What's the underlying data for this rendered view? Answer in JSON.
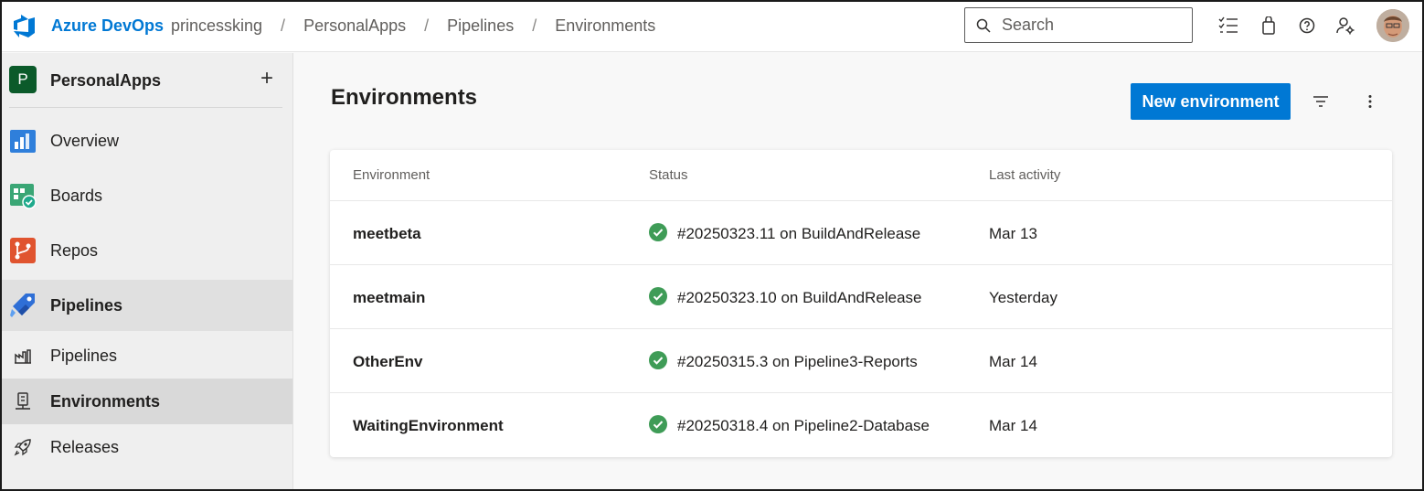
{
  "header": {
    "brand": "Azure DevOps",
    "breadcrumbs": [
      "princessking",
      "PersonalApps",
      "Pipelines",
      "Environments"
    ],
    "breadcrumb_separator": "/",
    "search_placeholder": "Search",
    "icons": [
      "checklist-icon",
      "shopping-bag-icon",
      "help-icon",
      "user-settings-icon"
    ]
  },
  "sidebar": {
    "project_initial": "P",
    "project_name": "PersonalApps",
    "add_label": "+",
    "items": [
      {
        "label": "Overview",
        "icon": "overview-icon"
      },
      {
        "label": "Boards",
        "icon": "boards-icon"
      },
      {
        "label": "Repos",
        "icon": "repos-icon"
      },
      {
        "label": "Pipelines",
        "icon": "pipelines-icon",
        "active": true
      }
    ],
    "subitems": [
      {
        "label": "Pipelines",
        "icon": "pipeline-list-icon"
      },
      {
        "label": "Environments",
        "icon": "environment-icon",
        "selected": true
      },
      {
        "label": "Releases",
        "icon": "rocket-icon"
      }
    ]
  },
  "main": {
    "title": "Environments",
    "new_button": "New environment",
    "table": {
      "columns": [
        "Environment",
        "Status",
        "Last activity"
      ],
      "rows": [
        {
          "name": "meetbeta",
          "status": "#20250323.11 on BuildAndRelease",
          "activity": "Mar 13"
        },
        {
          "name": "meetmain",
          "status": "#20250323.10 on BuildAndRelease",
          "activity": "Yesterday"
        },
        {
          "name": "OtherEnv",
          "status": "#20250315.3 on Pipeline3-Reports",
          "activity": "Mar 14"
        },
        {
          "name": "WaitingEnvironment",
          "status": "#20250318.4 on Pipeline2-Database",
          "activity": "Mar 14"
        }
      ]
    }
  },
  "colors": {
    "brand": "#0078d4",
    "success": "#3f9c57",
    "project_badge": "#0b5a2a"
  }
}
